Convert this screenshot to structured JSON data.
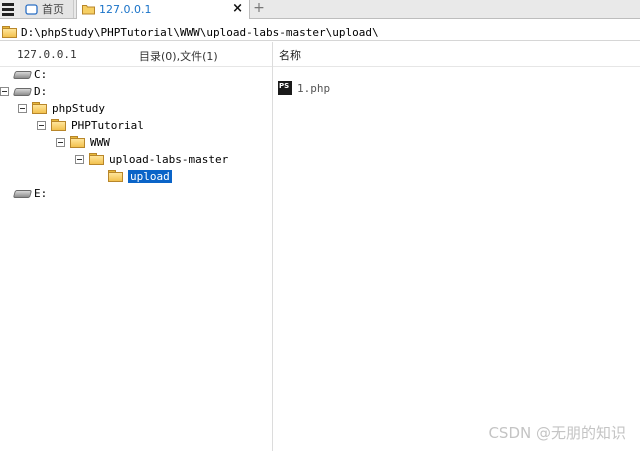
{
  "tabs": [
    {
      "label": "首页",
      "icon": "home-window-icon"
    },
    {
      "label": "127.0.0.1",
      "icon": "folder-icon",
      "active": true
    }
  ],
  "tab_close": "×",
  "tab_add": "+",
  "path": "D:\\phpStudy\\PHPTutorial\\WWW\\upload-labs-master\\upload\\",
  "left_header": {
    "host": "127.0.0.1",
    "count": "目录(0),文件(1)"
  },
  "right_header": {
    "name_col": "名称"
  },
  "tree": [
    {
      "label": "C:",
      "type": "drive"
    },
    {
      "label": "D:",
      "type": "drive",
      "expanded": true
    },
    {
      "label": "phpStudy",
      "type": "folder",
      "expanded": true
    },
    {
      "label": "PHPTutorial",
      "type": "folder",
      "expanded": true
    },
    {
      "label": "WWW",
      "type": "folder",
      "expanded": true
    },
    {
      "label": "upload-labs-master",
      "type": "folder",
      "expanded": true
    },
    {
      "label": "upload",
      "type": "folder",
      "selected": true
    },
    {
      "label": "E:",
      "type": "drive"
    }
  ],
  "files": [
    {
      "name": "1.php",
      "icon": "phpstorm-file-icon",
      "icon_text": "PS"
    }
  ],
  "watermark": "CSDN @无朋的知识",
  "colors": {
    "accent": "#1a73c8",
    "selection": "#0a64c8",
    "folder": "#f2c14e"
  }
}
